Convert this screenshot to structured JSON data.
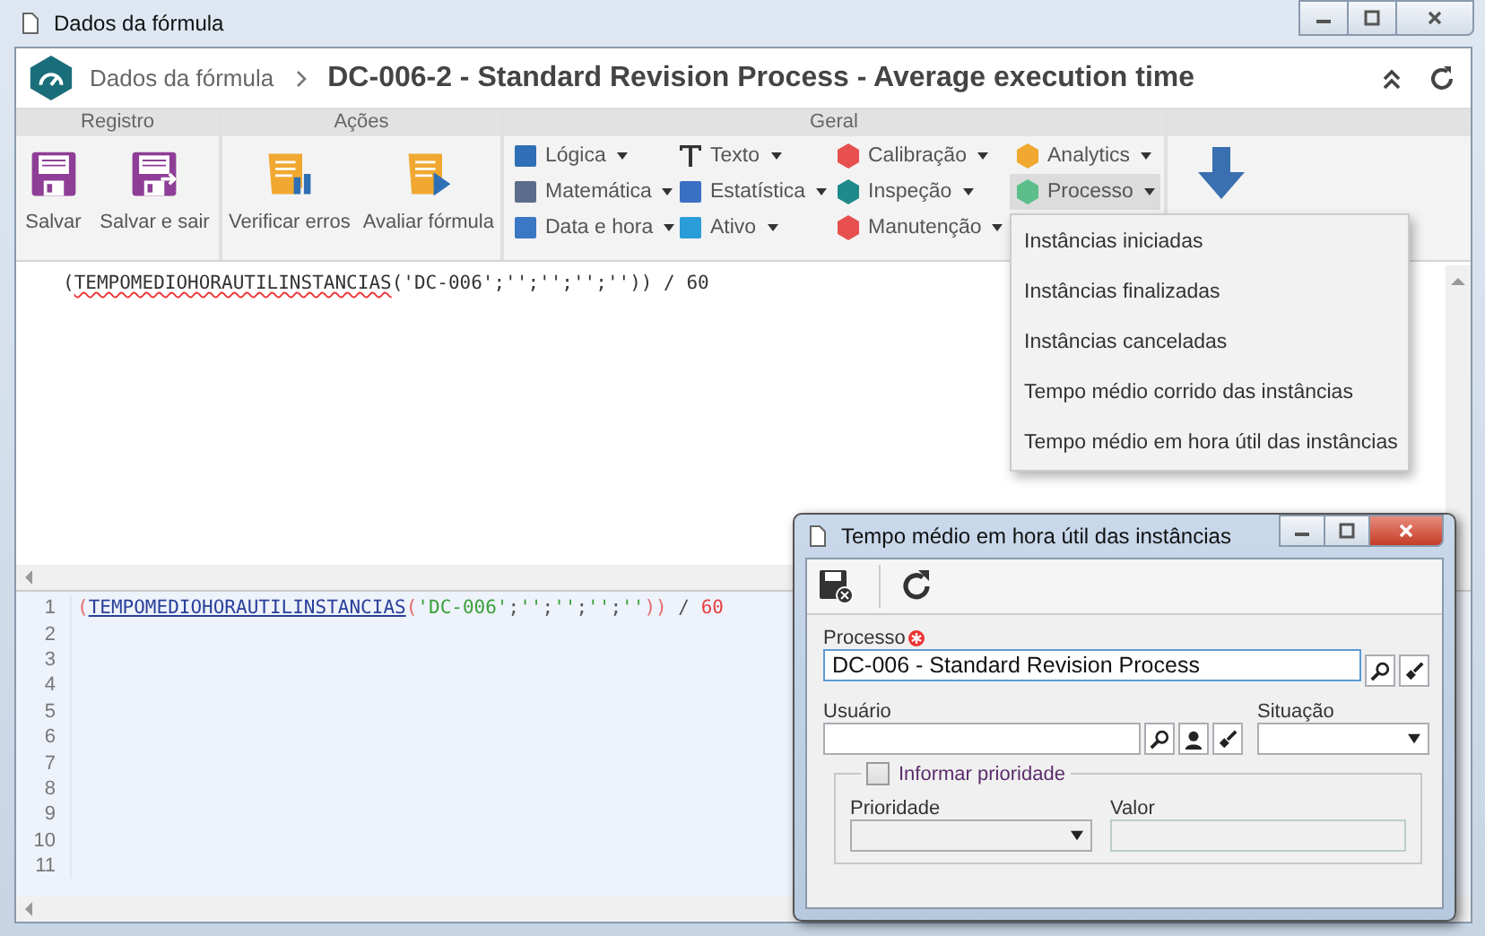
{
  "window": {
    "title": "Dados da fórmula"
  },
  "header": {
    "breadcrumb": "Dados da fórmula",
    "title": "DC-006-2 - Standard Revision Process - Average execution time"
  },
  "ribbon": {
    "groups": [
      {
        "label": "Registro",
        "kind": "buttons",
        "buttons": [
          "Salvar",
          "Salvar e sair"
        ]
      },
      {
        "label": "Ações",
        "kind": "buttons",
        "buttons": [
          "Verificar erros",
          "Avaliar fórmula"
        ]
      },
      {
        "label": "Geral",
        "kind": "menus",
        "columns": [
          [
            {
              "label": "Lógica",
              "selected": false
            },
            {
              "label": "Matemática",
              "selected": false
            },
            {
              "label": "Data e hora",
              "selected": false
            }
          ],
          [
            {
              "label": "Texto",
              "selected": false
            },
            {
              "label": "Estatística",
              "selected": false
            },
            {
              "label": "Ativo",
              "selected": false
            }
          ],
          [
            {
              "label": "Calibração",
              "selected": false
            },
            {
              "label": "Inspeção",
              "selected": false
            },
            {
              "label": "Manutenção",
              "selected": false
            }
          ],
          [
            {
              "label": "Analytics",
              "selected": false
            },
            {
              "label": "Processo",
              "selected": true
            }
          ]
        ]
      },
      {
        "kind": "arrow"
      }
    ]
  },
  "menu": {
    "items": [
      "Instâncias iniciadas",
      "Instâncias finalizadas",
      "Instâncias canceladas",
      "Tempo médio corrido das instâncias",
      "Tempo médio em hora útil das instâncias"
    ]
  },
  "preview": {
    "tokens": [
      {
        "text": "(",
        "kind": "plain"
      },
      {
        "text": "TEMPOMEDIOHORAUTILINSTANCIAS",
        "kind": "misspelled"
      },
      {
        "text": "('DC-006';'';'';'';'')) / 60",
        "kind": "plain"
      }
    ]
  },
  "editor": {
    "lines": [
      {
        "number": "1",
        "tokens": [
          {
            "text": "(",
            "kind": "paren"
          },
          {
            "text": "TEMPOMEDIOHORAUTILINSTANCIAS",
            "kind": "function"
          },
          {
            "text": "(",
            "kind": "paren"
          },
          {
            "text": "'DC-006'",
            "kind": "string"
          },
          {
            "text": ";",
            "kind": "plain"
          },
          {
            "text": "''",
            "kind": "string"
          },
          {
            "text": ";",
            "kind": "plain"
          },
          {
            "text": "''",
            "kind": "string"
          },
          {
            "text": ";",
            "kind": "plain"
          },
          {
            "text": "''",
            "kind": "string"
          },
          {
            "text": ";",
            "kind": "plain"
          },
          {
            "text": "''",
            "kind": "string"
          },
          {
            "text": "))",
            "kind": "paren"
          },
          {
            "text": " / ",
            "kind": "plain"
          },
          {
            "text": "60",
            "kind": "number"
          }
        ]
      },
      {
        "number": "2"
      },
      {
        "number": "3"
      },
      {
        "number": "4"
      },
      {
        "number": "5"
      },
      {
        "number": "6"
      },
      {
        "number": "7"
      },
      {
        "number": "8"
      },
      {
        "number": "9"
      },
      {
        "number": "10"
      },
      {
        "number": "11"
      }
    ]
  },
  "dialog": {
    "title": "Tempo médio em hora útil das instâncias",
    "processo": {
      "label": "Processo",
      "required": true,
      "value": "DC-006 - Standard Revision Process"
    },
    "usuario": {
      "label": "Usuário"
    },
    "situacao": {
      "label": "Situação"
    },
    "priority_group": {
      "label": "Informar prioridade",
      "checked": false
    },
    "prioridade": {
      "label": "Prioridade",
      "disabled": true
    },
    "valor": {
      "label": "Valor",
      "disabled": true
    }
  }
}
